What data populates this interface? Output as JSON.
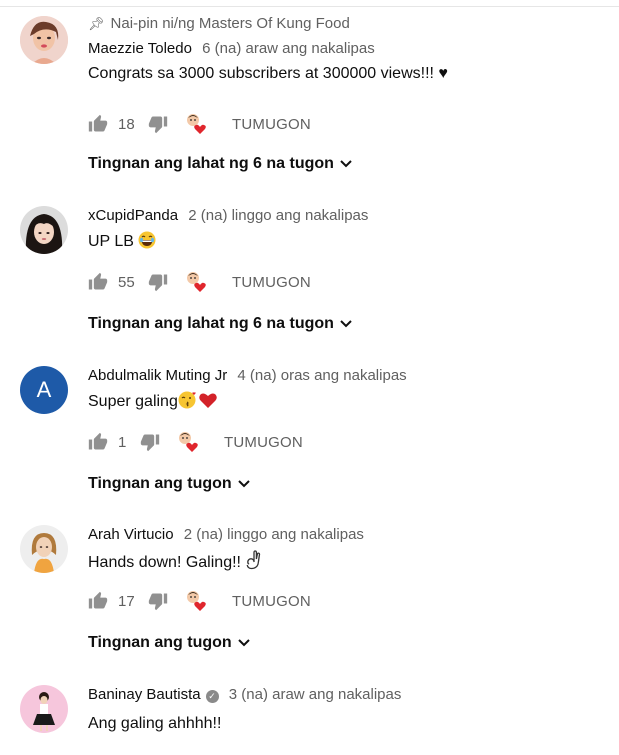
{
  "pinned_label": "Nai-pin ni/ng Masters Of Kung Food",
  "reply_label": "TUMUGON",
  "comments": [
    {
      "author": "Maezzie Toledo",
      "time": "6 (na) araw ang nakalipas",
      "text": "Congrats sa 3000 subscribers at 300000 views!!! ♥",
      "likes": "18",
      "view_replies": "Tingnan ang lahat ng 6 na tugon"
    },
    {
      "author": "xCupidPanda",
      "time": "2 (na) linggo ang nakalipas",
      "text": "UP LB",
      "likes": "55",
      "view_replies": "Tingnan ang lahat ng 6 na tugon"
    },
    {
      "author": "Abdulmalik Muting Jr",
      "avatar_letter": "A",
      "time": "4 (na) oras ang nakalipas",
      "text": "Super galing",
      "likes": "1",
      "view_replies": "Tingnan ang tugon"
    },
    {
      "author": "Arah Virtucio",
      "time": "2 (na) linggo ang nakalipas",
      "text": "Hands down! Galing!!",
      "likes": "17",
      "view_replies": "Tingnan ang tugon"
    },
    {
      "author": "Baninay Bautista",
      "time": "3 (na) araw ang nakalipas",
      "text": "Ang galing ahhhh!!"
    }
  ],
  "colors": {
    "avatar_letter_bg": "#1e5aa8",
    "heart": "#e0262d",
    "muted": "#606060"
  }
}
